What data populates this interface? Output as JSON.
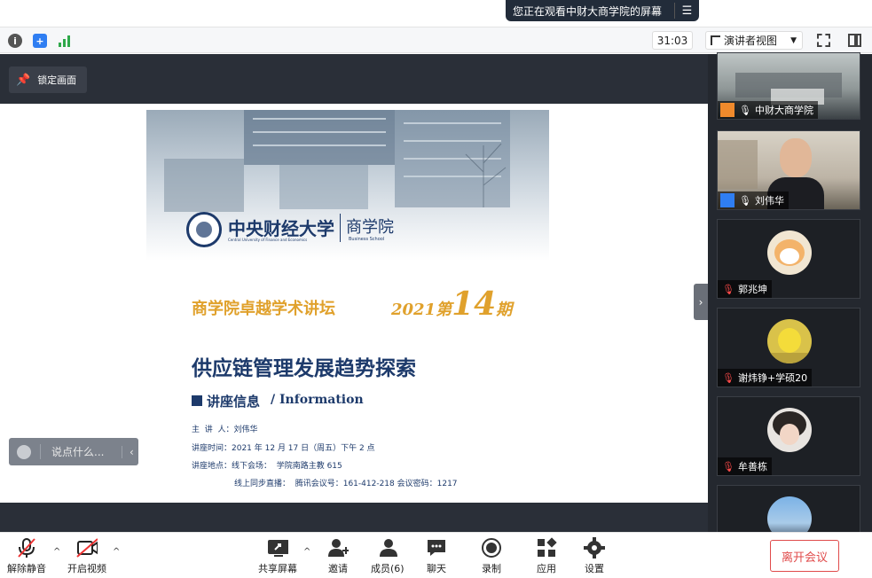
{
  "top": {
    "sharing_notice": "您正在观看中财大商学院的屏幕",
    "menu_icon": "menu-icon"
  },
  "infobar": {
    "timer": "31:03",
    "view_mode": "演讲者视图"
  },
  "stage": {
    "lock_label": "锁定画面",
    "chat_placeholder": "说点什么..."
  },
  "slide": {
    "university": "中央财经大学",
    "university_en": "Central University of Finance and Economics",
    "school": "商学院",
    "school_en": "Business School",
    "forum": "商学院卓越学术讲坛",
    "issue_prefix": "2021第",
    "issue_number": "14",
    "issue_suffix": "期",
    "title": "供应链管理发展趋势探索",
    "section": "讲座信息",
    "section_en": "/ Information",
    "details": [
      "主  讲  人：刘伟华",
      "讲座时间：2021 年 12 月 17 日（周五）下午 2 点",
      "讲座地点：线下会场：  学院南路主教 615",
      "线上同步直播：  腾讯会议号：161-412-218 会议密码：1217"
    ]
  },
  "participants": [
    {
      "name": "中财大商学院"
    },
    {
      "name": "刘伟华"
    },
    {
      "name": "郭兆坤"
    },
    {
      "name": "谢炜铮+学硕20"
    },
    {
      "name": "牟善栋"
    },
    {
      "name": ""
    }
  ],
  "toolbar": {
    "unmute": "解除静音",
    "start_video": "开启视频",
    "share_screen": "共享屏幕",
    "invite": "邀请",
    "members": "成员(6)",
    "chat": "聊天",
    "record": "录制",
    "apps": "应用",
    "settings": "设置",
    "leave": "离开会议"
  }
}
